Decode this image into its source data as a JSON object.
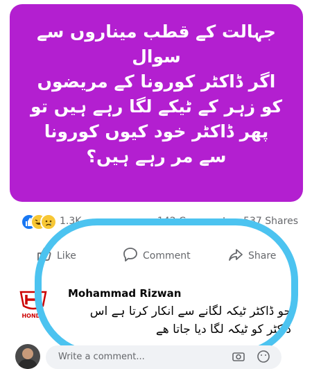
{
  "post": {
    "background_color": "#b31fd0",
    "text_lines": [
      "جہالت کے قطب میناروں سے",
      "سوال",
      "اگر ڈاکٹر کورونا کے مریضوں",
      "کو زہر کے ٹیکے لگا رہے ہیں تو",
      "پھر ڈاکٹر خود کیوں کورونا",
      "سے مر رہے ہیں؟"
    ]
  },
  "reactions": {
    "icons": [
      "like-icon",
      "haha-icon",
      "sad-icon"
    ],
    "count": "1.3K",
    "stats": "142 Comments • 537 Shares"
  },
  "actions": {
    "like": "Like",
    "comment": "Comment",
    "share": "Share"
  },
  "comment": {
    "author": "Mohammad Rizwan",
    "text": "جو ڈاکٹر ٹیکہ لگانے سے انکار کرتا ہے اس ڈاکٹر کو ٹیکہ لگا دیا جاتا ھے",
    "avatar_brand": "HONDA",
    "highlight_color": "#4cc3f0"
  },
  "composer": {
    "placeholder": "Write a comment..."
  }
}
